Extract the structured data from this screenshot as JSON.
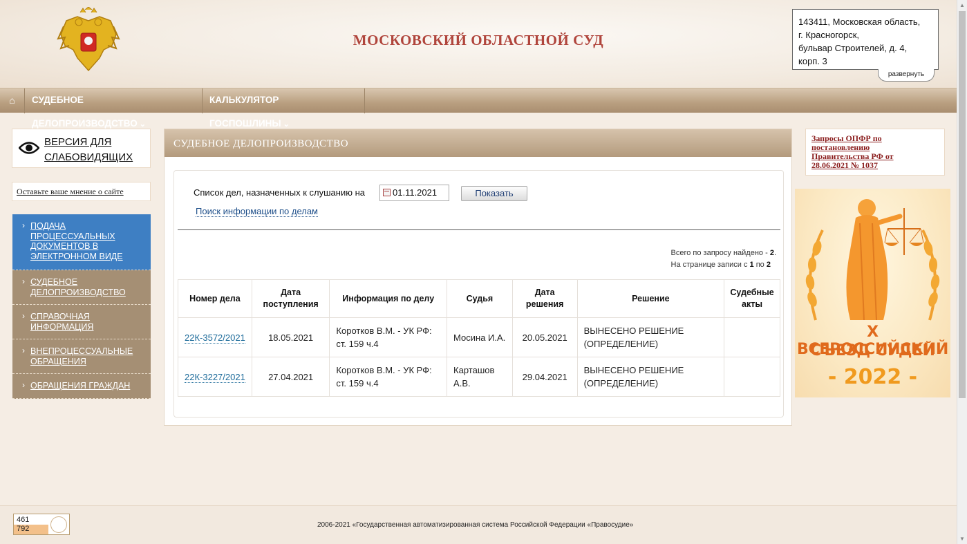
{
  "header": {
    "title": "МОСКОВСКИЙ ОБЛАСТНОЙ СУД",
    "address_lines": [
      "143411, Московская область,",
      "г. Красногорск,",
      "бульвар Строителей, д. 4,",
      "корп. 3"
    ],
    "expand_label": "развернуть"
  },
  "nav": {
    "home_icon": "⌂",
    "items": [
      {
        "label": "СУДЕБНОЕ ДЕЛОПРОИЗВОДСТВО",
        "chevron": "⌄"
      },
      {
        "label": "КАЛЬКУЛЯТОР ГОСПОШЛИНЫ",
        "chevron": "⌄"
      }
    ]
  },
  "sidebar": {
    "vision_label_1": "ВЕРСИЯ ДЛЯ",
    "vision_label_2": "СЛАБОВИДЯЩИХ",
    "opinion_label": "Оставьте ваше мнение о сайте",
    "menu": [
      {
        "lines": [
          "ПОДАЧА",
          "ПРОЦЕССУАЛЬНЫХ",
          "ДОКУМЕНТОВ В",
          "ЭЛЕКТРОННОМ ВИДЕ"
        ]
      },
      {
        "lines": [
          "СУДЕБНОЕ",
          "ДЕЛОПРОИЗВОДСТВО"
        ]
      },
      {
        "lines": [
          "СПРАВОЧНАЯ",
          "ИНФОРМАЦИЯ"
        ]
      },
      {
        "lines": [
          "ВНЕПРОЦЕССУАЛЬНЫЕ",
          "ОБРАЩЕНИЯ"
        ]
      },
      {
        "lines": [
          "ОБРАЩЕНИЯ ГРАЖДАН"
        ]
      }
    ],
    "menu_arrow": "›"
  },
  "main": {
    "section_title": "СУДЕБНОЕ ДЕЛОПРОИЗВОДСТВО",
    "list_label": "Список дел, назначенных к слушанию на",
    "date_value": "01.11.2021",
    "show_button": "Показать",
    "search_link": "Поиск информации по делам",
    "found_prefix": "Всего по запросу найдено - ",
    "found_count": "2",
    "found_suffix": ".",
    "page_prefix": "На странице записи с ",
    "page_from": "1",
    "page_mid": " по ",
    "page_to": "2",
    "columns": [
      [
        "Номер дела"
      ],
      [
        "Дата",
        "поступления"
      ],
      [
        "Информация по делу"
      ],
      [
        "Судья"
      ],
      [
        "Дата",
        "решения"
      ],
      [
        "Решение"
      ],
      [
        "Судебные",
        "акты"
      ]
    ],
    "rows": [
      {
        "case": "22К-3572/2021",
        "received": "18.05.2021",
        "info": [
          "Коротков В.М. - УК РФ:",
          "ст. 159 ч.4"
        ],
        "judge": [
          "Мосина И.А."
        ],
        "decided": "20.05.2021",
        "decision": [
          "ВЫНЕСЕНО РЕШЕНИЕ",
          "(ОПРЕДЕЛЕНИЕ)"
        ],
        "acts": ""
      },
      {
        "case": "22К-3227/2021",
        "received": "27.04.2021",
        "info": [
          "Коротков В.М. - УК РФ:",
          "ст. 159 ч.4"
        ],
        "judge": [
          "Карташов",
          "А.В."
        ],
        "decided": "29.04.2021",
        "decision": [
          "ВЫНЕСЕНО РЕШЕНИЕ",
          "(ОПРЕДЕЛЕНИЕ)"
        ],
        "acts": ""
      }
    ]
  },
  "right": {
    "request_link": [
      "Запросы ОПФР по",
      "постановлению",
      "Правительства РФ от",
      "28.06.2021 № 1037"
    ],
    "banner_line1": "X ВСЕРОССИЙСКИЙ",
    "banner_line2": "СЪЕЗД СУДЕЙ",
    "banner_year": "- 2022 -"
  },
  "footer": {
    "counter_1": "461",
    "counter_2": "792",
    "copyright": "2006-2021 «Государственная автоматизированная система Российской Федерации «Правосудие»"
  },
  "colors": {
    "title_red": "#b0453c",
    "nav_brown": "#b99f80",
    "menu_active_blue": "#3e7fc3",
    "menu_brown": "#a58f74",
    "link_blue": "#1d6b9a"
  },
  "icons": {
    "emblem": "coat-of-arms-icon",
    "eye": "eye-icon",
    "calendar": "calendar-icon",
    "home": "home-icon",
    "counter": "scales-icon"
  }
}
